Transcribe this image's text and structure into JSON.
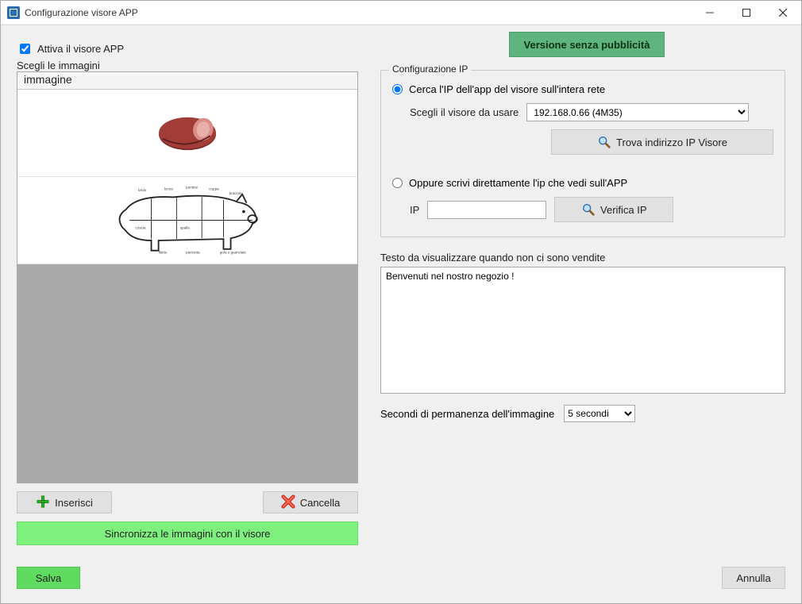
{
  "window": {
    "title": "Configurazione visore APP"
  },
  "activate": {
    "label": "Attiva il visore APP",
    "checked": true
  },
  "images": {
    "choose_label": "Scegli le immagini",
    "column_header": "immagine"
  },
  "buttons": {
    "insert": "Inserisci",
    "delete": "Cancella",
    "sync": "Sincronizza le immagini con il visore",
    "version_no_ads": "Versione senza pubblicità",
    "find_ip": "Trova indirizzo IP Visore",
    "verify_ip": "Verifica IP",
    "save": "Salva",
    "cancel": "Annulla"
  },
  "ip_config": {
    "group_title": "Configurazione IP",
    "radio_search": "Cerca l'IP dell'app del visore sull'intera rete",
    "choose_viewer_label": "Scegli il visore da usare",
    "viewer_selected": "192.168.0.66 (4M35)",
    "radio_manual": "Oppure scrivi direttamente l'ip che vedi sull'APP",
    "ip_label": "IP",
    "ip_value": ""
  },
  "idle_text": {
    "label": "Testo da visualizzare quando non ci sono vendite",
    "value": "Benvenuti nel nostro negozio !"
  },
  "seconds": {
    "label": "Secondi di permanenza dell'immagine",
    "selected": "5 secondi"
  }
}
